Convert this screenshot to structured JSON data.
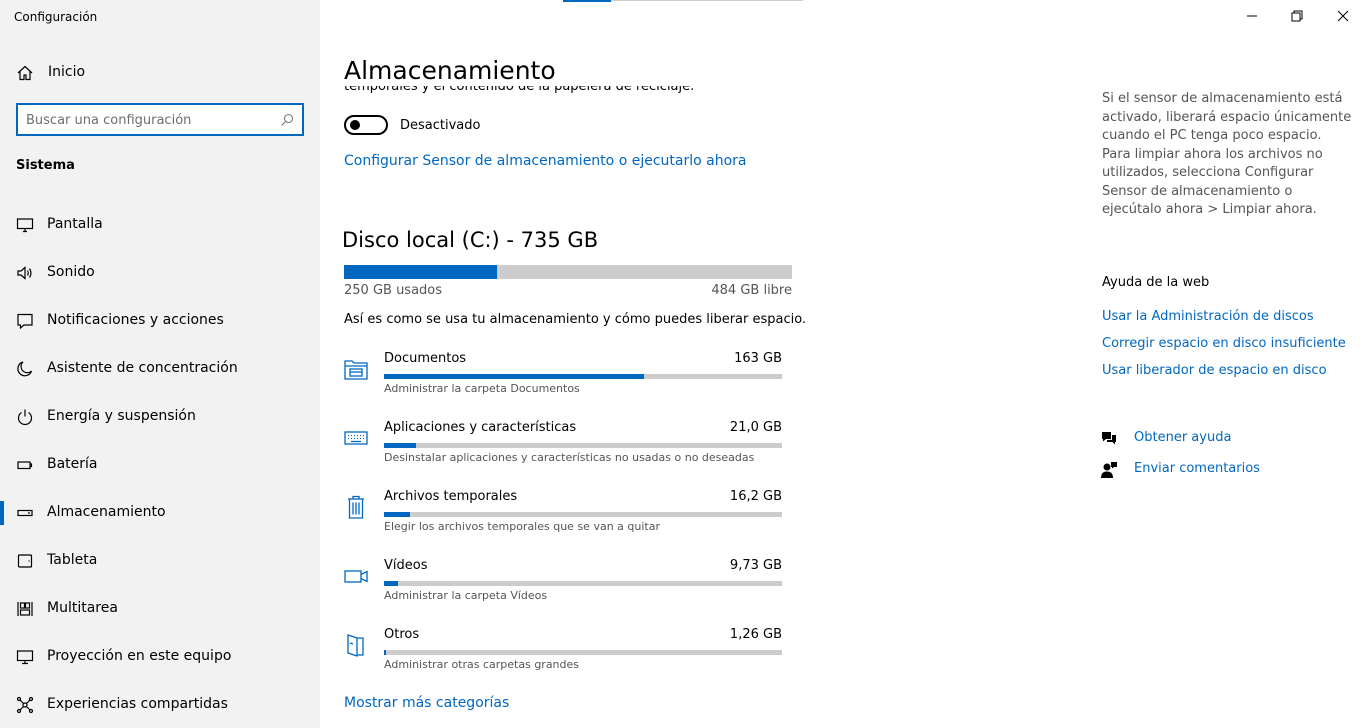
{
  "window": {
    "title": "Configuración",
    "minimize_icon": "minimize-icon",
    "restore_icon": "restore-icon",
    "close_icon": "close-icon"
  },
  "sidebar": {
    "home_label": "Inicio",
    "search_placeholder": "Buscar una configuración",
    "section": "Sistema",
    "items": [
      {
        "label": "Pantalla",
        "icon": "monitor-icon"
      },
      {
        "label": "Sonido",
        "icon": "speaker-icon"
      },
      {
        "label": "Notificaciones y acciones",
        "icon": "notification-icon"
      },
      {
        "label": "Asistente de concentración",
        "icon": "moon-icon"
      },
      {
        "label": "Energía y suspensión",
        "icon": "power-icon"
      },
      {
        "label": "Batería",
        "icon": "battery-icon"
      },
      {
        "label": "Almacenamiento",
        "icon": "storage-icon",
        "active": true
      },
      {
        "label": "Tableta",
        "icon": "tablet-icon"
      },
      {
        "label": "Multitarea",
        "icon": "multitask-icon"
      },
      {
        "label": "Proyección en este equipo",
        "icon": "projection-icon"
      },
      {
        "label": "Experiencias compartidas",
        "icon": "share-icon"
      }
    ]
  },
  "main": {
    "title": "Almacenamiento",
    "clipped_text": "temporales y el contenido de la papelera de reciclaje.",
    "toggle_label": "Desactivado",
    "toggle_state": "off",
    "configure_link": "Configurar Sensor de almacenamiento o ejecutarlo ahora",
    "disk": {
      "title": "Disco local (C:) - 735 GB",
      "used_label": "250 GB usados",
      "free_label": "484 GB libre",
      "used_fraction": 0.3417
    },
    "usage_desc": "Así es como se usa tu almacenamiento y cómo puedes liberar espacio.",
    "categories": [
      {
        "name": "Documentos",
        "size": "163 GB",
        "sub": "Administrar la carpeta Documentos",
        "fraction": 0.653,
        "icon": "documents-folder-icon"
      },
      {
        "name": "Aplicaciones y características",
        "size": "21,0 GB",
        "sub": "Desinstalar aplicaciones y características no usadas o no deseadas",
        "fraction": 0.08,
        "icon": "keyboard-icon"
      },
      {
        "name": "Archivos temporales",
        "size": "16,2 GB",
        "sub": "Elegir los archivos temporales que se van a quitar",
        "fraction": 0.065,
        "icon": "trash-icon"
      },
      {
        "name": "Vídeos",
        "size": "9,73 GB",
        "sub": "Administrar la carpeta Vídeos",
        "fraction": 0.035,
        "icon": "video-camera-icon"
      },
      {
        "name": "Otros",
        "size": "1,26 GB",
        "sub": "Administrar otras carpetas grandes",
        "fraction": 0.005,
        "icon": "other-folder-icon"
      }
    ],
    "more_link": "Mostrar más categorías"
  },
  "right": {
    "info_text": "Si el sensor de almacenamiento está activado, liberará espacio únicamente cuando el PC tenga poco espacio. Para limpiar ahora los archivos no utilizados, selecciona Configurar Sensor de almacenamiento o ejecútalo ahora > Limpiar ahora.",
    "web_help_title": "Ayuda de la web",
    "links": [
      "Usar la Administración de discos",
      "Corregir espacio en disco insuficiente",
      "Usar liberador de espacio en disco"
    ],
    "get_help": "Obtener ayuda",
    "feedback": "Enviar comentarios"
  },
  "colors": {
    "accent": "#0067c0",
    "sidebar_bg": "#f2f2f2",
    "bar_track": "#cccccc"
  }
}
